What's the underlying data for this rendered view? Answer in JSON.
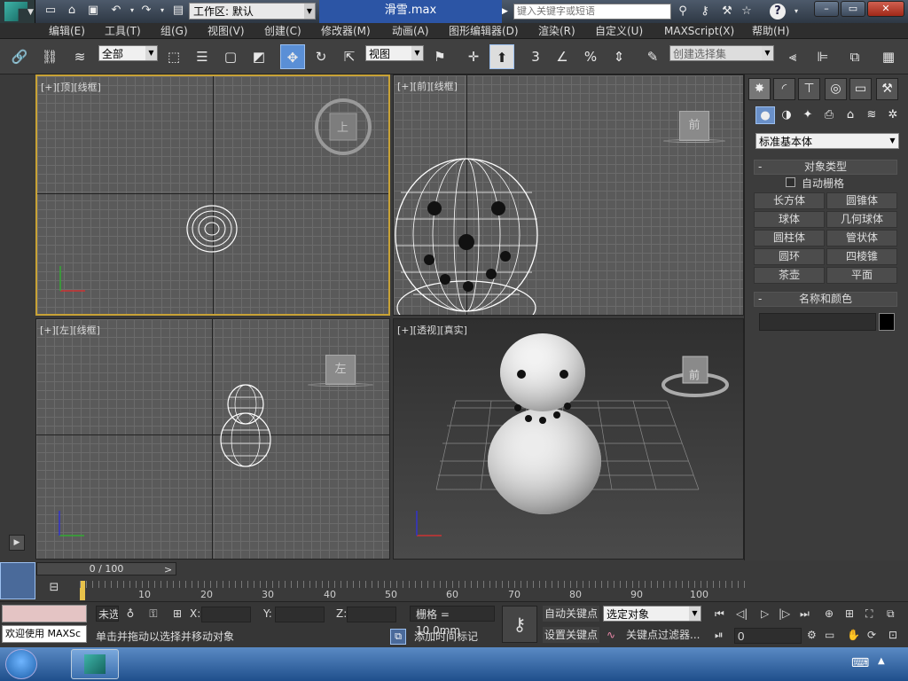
{
  "titlebar": {
    "workspace_label": "工作区: 默认",
    "document_title": "滑雪.max",
    "search_placeholder": "键入关键字或短语"
  },
  "menu": [
    "编辑(E)",
    "工具(T)",
    "组(G)",
    "视图(V)",
    "创建(C)",
    "修改器(M)",
    "动画(A)",
    "图形编辑器(D)",
    "渲染(R)",
    "自定义(U)",
    "MAXScript(X)",
    "帮助(H)"
  ],
  "toolbar": {
    "filter_value": "全部",
    "coord_value": "视图",
    "snap_angle_label": "3",
    "named_selection_placeholder": "创建选择集"
  },
  "viewports": [
    {
      "label": "[+][顶][线框]",
      "cube_label": "上"
    },
    {
      "label": "[+][前][线框]",
      "cube_label": "前"
    },
    {
      "label": "[+][左][线框]",
      "cube_label": "左"
    },
    {
      "label": "[+][透视][真实]",
      "cube_label": "前"
    }
  ],
  "command_panel": {
    "category": "标准基本体",
    "object_type_header": "对象类型",
    "autogrid_label": "自动栅格",
    "objects": [
      "长方体",
      "圆锥体",
      "球体",
      "几何球体",
      "圆柱体",
      "管状体",
      "圆环",
      "四棱锥",
      "茶壶",
      "平面"
    ],
    "name_color_header": "名称和颜色",
    "object_color": "#000000"
  },
  "timeline": {
    "frame_display": "0 / 100",
    "ticks": [
      "10",
      "20",
      "30",
      "40",
      "50",
      "60",
      "70",
      "80",
      "90",
      "100"
    ]
  },
  "status": {
    "welcome": "欢迎使用 MAXSc",
    "selection_state": "未选",
    "x_label": "X:",
    "y_label": "Y:",
    "z_label": "Z:",
    "grid_label": "栅格 = 10.0mm",
    "auto_key": "自动关键点",
    "set_key": "设置关键点",
    "selected_object": "选定对象",
    "key_filter": "关键点过滤器...",
    "hint": "单击并拖动以选择并移动对象",
    "add_time_tag": "添加时间标记",
    "current_frame": "0"
  }
}
